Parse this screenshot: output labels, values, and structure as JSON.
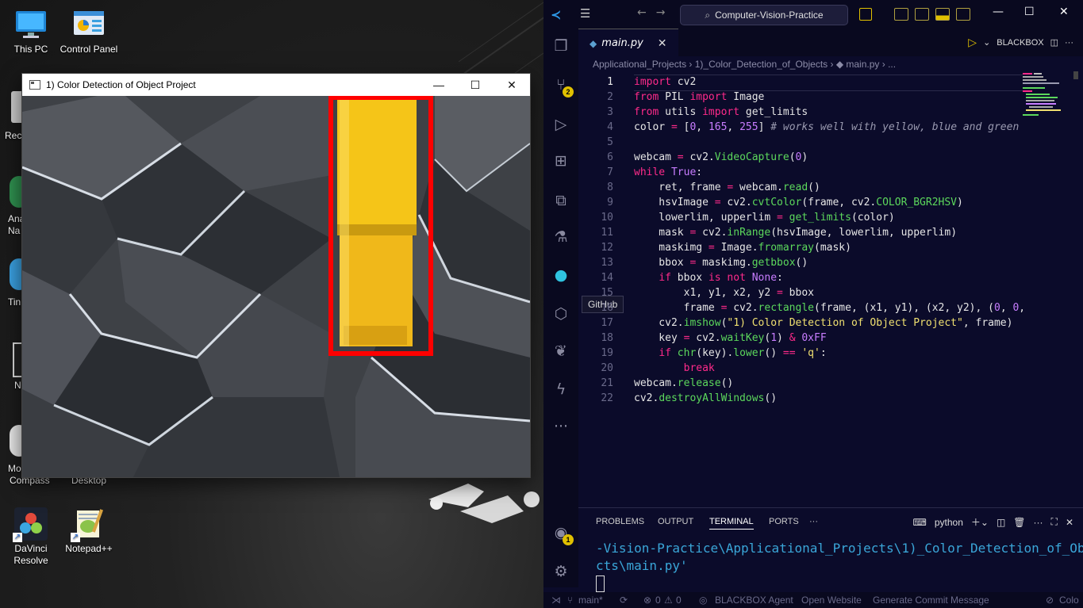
{
  "desktop": {
    "icons": [
      {
        "label": "This PC",
        "icon": "monitor-icon"
      },
      {
        "label": "Control Panel",
        "icon": "control-panel-icon"
      },
      {
        "label": "Desktop",
        "icon": "folder-icon"
      },
      {
        "label": "DaVinci Resolve",
        "icon": "davinci-resolve-icon"
      },
      {
        "label": "Notepad++",
        "icon": "notepad-plus-plus-icon"
      }
    ],
    "partial_labels": [
      "Rec",
      "Ana",
      "Na",
      "Tin",
      "N",
      "Mo",
      "Compass"
    ]
  },
  "cv_window": {
    "title": "1) Color Detection of Object Project",
    "minimize": "—",
    "maximize": "☐",
    "close": "✕",
    "bbox_color": "#ff0000",
    "object_color": "#f5c518"
  },
  "vscode": {
    "search": "Computer-Vision-Practice",
    "tab": {
      "name": "main.py",
      "close": "✕"
    },
    "blackbox_label": "BLACKBOX",
    "breadcrumb": "Applicational_Projects  ›  1)_Color_Detection_of_Objects  ›  ◆ main.py  ›  ...",
    "tooltip": "GitHub",
    "badges": {
      "source_control": "2",
      "accounts": "1"
    },
    "code": [
      {
        "n": "1",
        "html": "<span class=\"kw\">import</span> cv2"
      },
      {
        "n": "2",
        "html": "<span class=\"kw\">from</span> PIL <span class=\"kw\">import</span> Image"
      },
      {
        "n": "3",
        "html": "<span class=\"kw\">from</span> utils <span class=\"kw\">import</span> get_limits"
      },
      {
        "n": "4",
        "html": "color <span class=\"op\">=</span> [<span class=\"num\">0</span>, <span class=\"num\">165</span>, <span class=\"num\">255</span>] <span class=\"cm\"># works well with yellow, blue and green</span>"
      },
      {
        "n": "5",
        "html": ""
      },
      {
        "n": "6",
        "html": "webcam <span class=\"op\">=</span> cv2.<span class=\"fn\">VideoCapture</span>(<span class=\"num\">0</span>)"
      },
      {
        "n": "7",
        "html": "<span class=\"kw\">while</span> <span class=\"num\">True</span>:"
      },
      {
        "n": "8",
        "html": "    ret, frame <span class=\"op\">=</span> webcam.<span class=\"fn\">read</span>()"
      },
      {
        "n": "9",
        "html": "    hsvImage <span class=\"op\">=</span> cv2.<span class=\"fn\">cvtColor</span>(frame, cv2.<span class=\"cls\">COLOR_BGR2HSV</span>)"
      },
      {
        "n": "10",
        "html": "    lowerlim, upperlim <span class=\"op\">=</span> <span class=\"fn\">get_limits</span>(color)"
      },
      {
        "n": "11",
        "html": "    mask <span class=\"op\">=</span> cv2.<span class=\"fn\">inRange</span>(hsvImage, lowerlim, upperlim)"
      },
      {
        "n": "12",
        "html": "    maskimg <span class=\"op\">=</span> Image.<span class=\"fn\">fromarray</span>(mask)"
      },
      {
        "n": "13",
        "html": "    bbox <span class=\"op\">=</span> maskimg.<span class=\"fn\">getbbox</span>()"
      },
      {
        "n": "14",
        "html": "    <span class=\"kw\">if</span> bbox <span class=\"kw\">is not</span> <span class=\"num\">None</span>:"
      },
      {
        "n": "15",
        "html": "        x1, y1, x2, y2 <span class=\"op\">=</span> bbox"
      },
      {
        "n": "16",
        "html": "        frame <span class=\"op\">=</span> cv2.<span class=\"fn\">rectangle</span>(frame, (x1, y1), (x2, y2), (<span class=\"num\">0</span>, <span class=\"num\">0</span>,"
      },
      {
        "n": "17",
        "html": "    cv2.<span class=\"fn\">imshow</span>(<span class=\"st\">\"1) Color Detection of Object Project\"</span>, frame)"
      },
      {
        "n": "18",
        "html": "    key <span class=\"op\">=</span> cv2.<span class=\"fn\">waitKey</span>(<span class=\"num\">1</span>) <span class=\"op\">&amp;</span> <span class=\"num\">0xFF</span>"
      },
      {
        "n": "19",
        "html": "    <span class=\"kw\">if</span> <span class=\"fn\">chr</span>(key).<span class=\"fn\">lower</span>() <span class=\"op\">==</span> <span class=\"st\">'q'</span>:"
      },
      {
        "n": "20",
        "html": "        <span class=\"kw\">break</span>"
      },
      {
        "n": "21",
        "html": "webcam.<span class=\"fn\">release</span>()"
      },
      {
        "n": "22",
        "html": "cv2.<span class=\"fn\">destroyAllWindows</span>()"
      }
    ],
    "panel_tabs": [
      "PROBLEMS",
      "OUTPUT",
      "TERMINAL",
      "PORTS",
      "···"
    ],
    "active_panel_tab": "TERMINAL",
    "terminal_shell": "python",
    "terminal_lines": [
      "-Vision-Practice\\Applicational_Projects\\1)_Color_Detection_of_Obje",
      "cts\\main.py'"
    ],
    "status": {
      "branch": "main*",
      "errors": "0",
      "warnings": "0",
      "blackbox_agent": "BLACKBOX Agent",
      "open_website": "Open Website",
      "commit": "Generate Commit Message",
      "color": "Colo"
    }
  }
}
